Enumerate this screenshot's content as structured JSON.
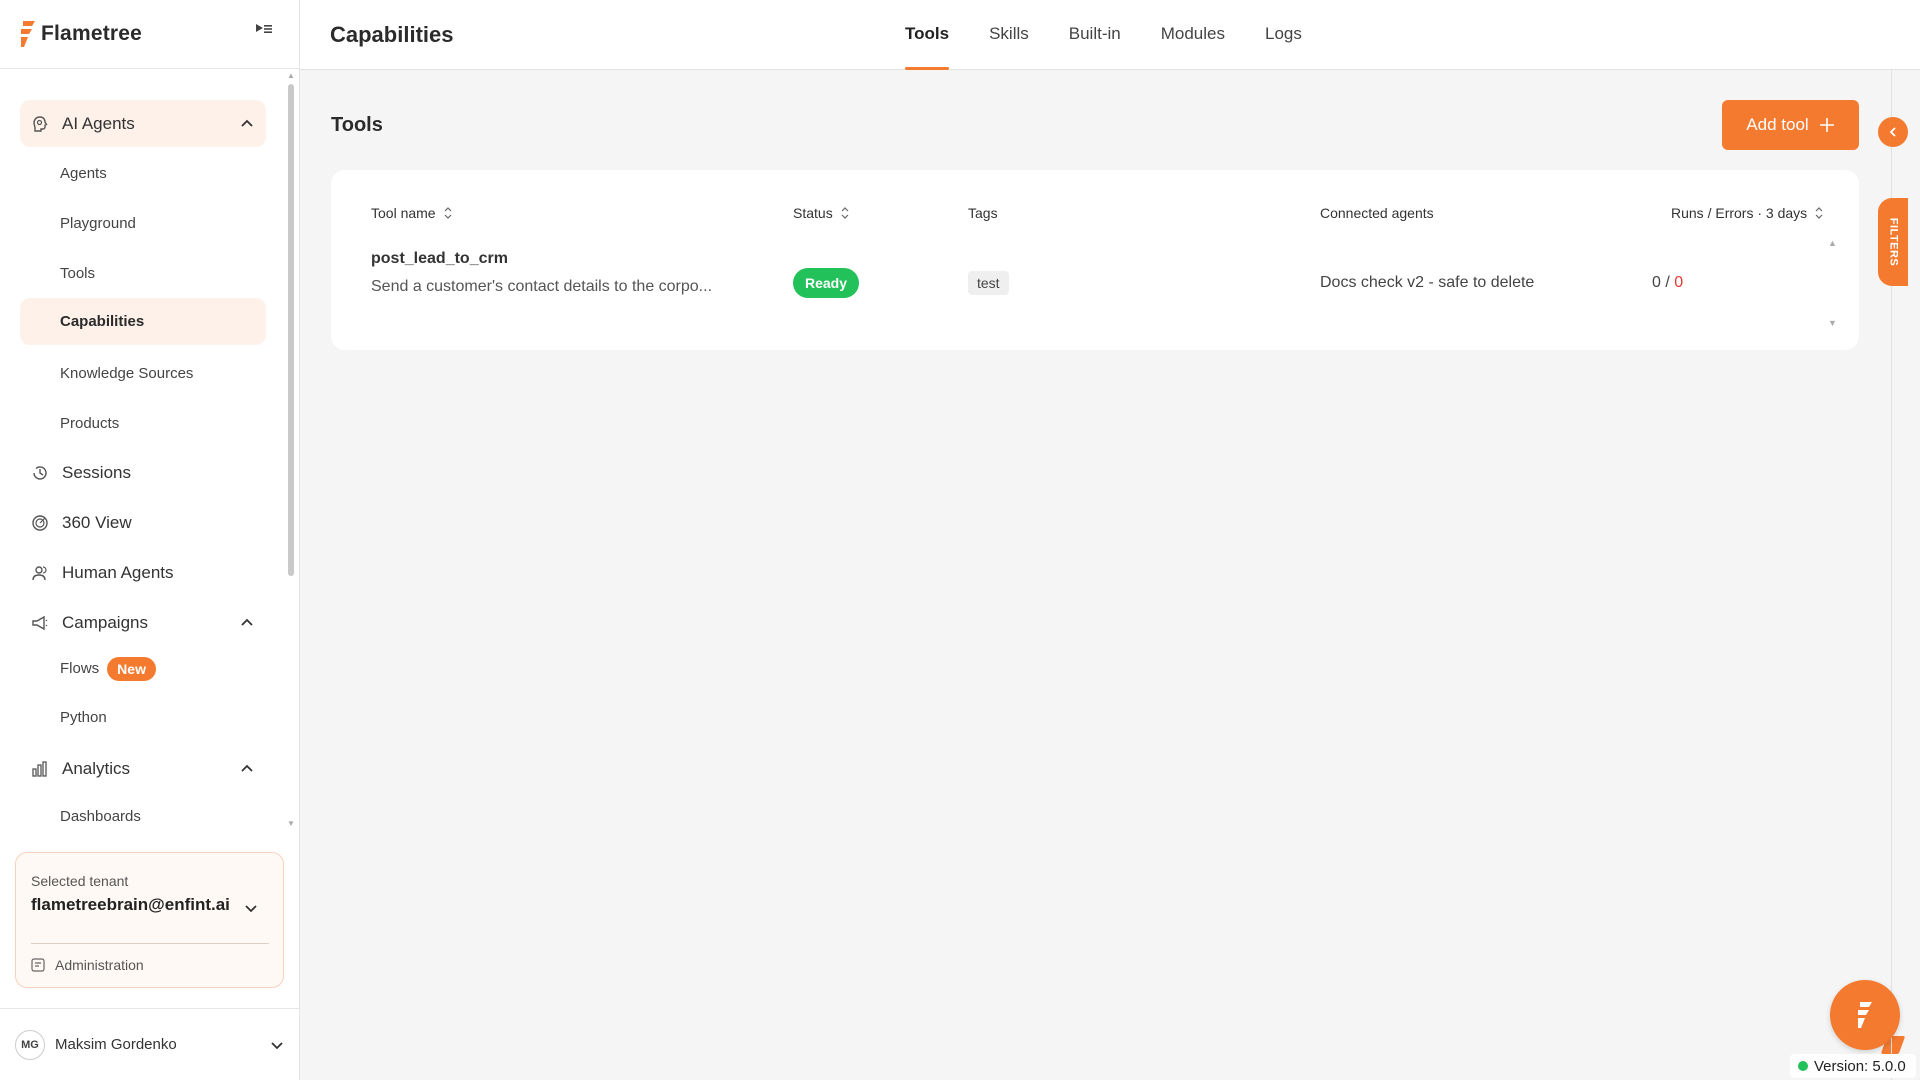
{
  "brand": {
    "name": "Flametree",
    "accent": "#f47a30"
  },
  "sidebar": {
    "items": [
      {
        "label": "AI Agents",
        "icon": "brain-icon"
      },
      {
        "label": "Agents"
      },
      {
        "label": "Playground"
      },
      {
        "label": "Tools"
      },
      {
        "label": "Capabilities"
      },
      {
        "label": "Knowledge Sources"
      },
      {
        "label": "Products"
      },
      {
        "label": "Sessions",
        "icon": "clock-history-icon"
      },
      {
        "label": "360 View",
        "icon": "radar-icon"
      },
      {
        "label": "Human Agents",
        "icon": "users-icon"
      },
      {
        "label": "Campaigns",
        "icon": "megaphone-icon"
      },
      {
        "label": "Flows",
        "badge": "New"
      },
      {
        "label": "Python"
      },
      {
        "label": "Analytics",
        "icon": "bar-chart-icon"
      },
      {
        "label": "Dashboards"
      }
    ],
    "tenant": {
      "label": "Selected tenant",
      "value": "flametreebrain@enfint.ai"
    },
    "administration": "Administration",
    "user": {
      "initials": "MG",
      "name": "Maksim Gordenko"
    }
  },
  "header": {
    "title": "Capabilities",
    "tabs": [
      "Tools",
      "Skills",
      "Built-in",
      "Modules",
      "Logs"
    ],
    "active_tab": "Tools"
  },
  "main": {
    "section_title": "Tools",
    "add_button": "Add tool",
    "filters_label": "FILTERS",
    "table": {
      "columns": [
        "Tool name",
        "Status",
        "Tags",
        "Connected agents",
        "Runs / Errors · 3 days"
      ],
      "rows": [
        {
          "name": "post_lead_to_crm",
          "description": "Send a customer's contact details to the corpo...",
          "status": "Ready",
          "tag": "test",
          "agent": "Docs check v2 - safe to delete",
          "runs": "0",
          "errors": "0"
        }
      ]
    }
  },
  "version": "Version: 5.0.0",
  "colors": {
    "accent": "#f47a30",
    "ready": "#22c15a",
    "error": "#e53935"
  }
}
